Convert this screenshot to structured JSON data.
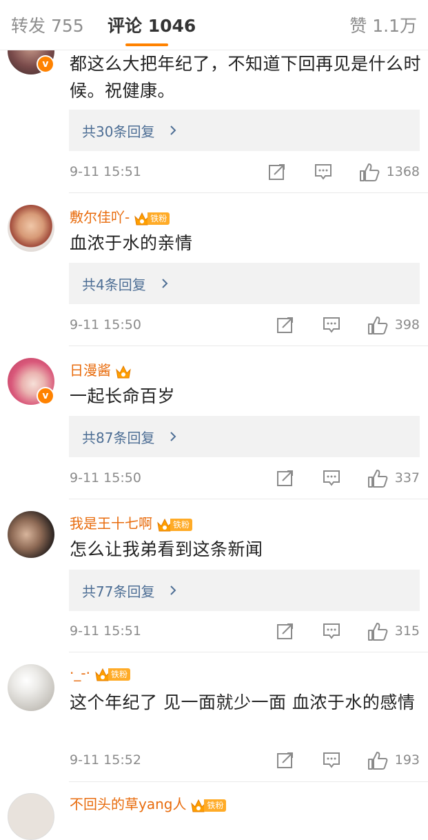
{
  "tabs": {
    "repost": "转发 755",
    "comments": "评论 1046",
    "likes": "赞 1.1万"
  },
  "fan_badge_label": "铁粉",
  "verified_mark": "v",
  "colors": {
    "accent_orange": "#ff8200",
    "username": "#e86b0c",
    "reply_link": "#4c6d94",
    "meta_gray": "#8a8a8a"
  },
  "comments": [
    {
      "text": "都这么大把年纪了，不知道下回再见是什么时候。祝健康。",
      "replies": "共30条回复",
      "time": "9-11 15:51",
      "likes": "1368"
    },
    {
      "username": "敷尔佳吖-",
      "text": "血浓于水的亲情",
      "replies": "共4条回复",
      "time": "9-11 15:50",
      "likes": "398"
    },
    {
      "username": "日漫酱",
      "text": "一起长命百岁",
      "replies": "共87条回复",
      "time": "9-11 15:50",
      "likes": "337"
    },
    {
      "username": "我是王十七啊",
      "text": "怎么让我弟看到这条新闻",
      "replies": "共77条回复",
      "time": "9-11 15:51",
      "likes": "315"
    },
    {
      "username": "·_-·",
      "text": "这个年纪了 见一面就少一面 血浓于水的感情",
      "time": "9-11 15:52",
      "likes": "193"
    },
    {
      "username": "不回头的草yang人"
    }
  ],
  "icons": {
    "repost": "repost-icon",
    "comment": "comment-icon",
    "like": "thumbs-up-icon",
    "more_replies": "chevron-right-icon",
    "fan_crown": "crown-icon"
  }
}
